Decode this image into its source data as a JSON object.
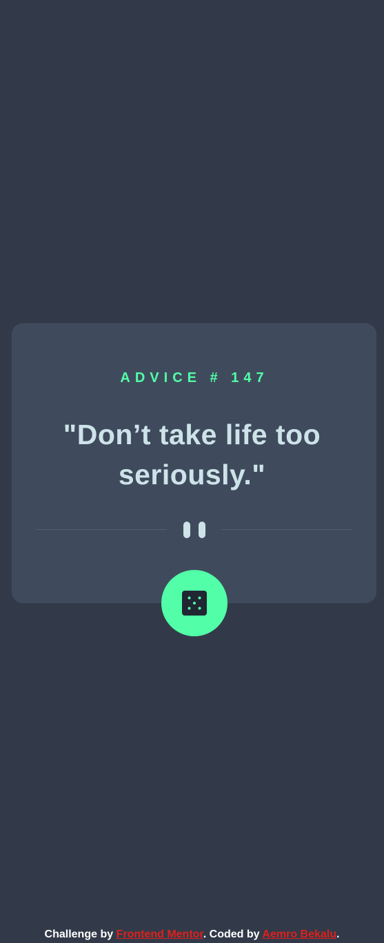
{
  "advice": {
    "id_label": "ADVICE # 147",
    "quote": "\"Don’t take life too seriously.\""
  },
  "divider": {
    "icon": "pause-icon"
  },
  "dice_button": {
    "icon": "dice-icon"
  },
  "footer": {
    "challenge_prefix": "Challenge by ",
    "challenge_link": "Frontend Mentor",
    "coded_prefix": ". Coded by ",
    "author_link": "Aemro Bekalu",
    "suffix": "."
  },
  "colors": {
    "background": "#323a49",
    "card": "#3f4b5c",
    "accent": "#52ffa8",
    "quote_text": "#cee3e9",
    "divider_line": "#4f5d74",
    "link": "#e0201b"
  }
}
